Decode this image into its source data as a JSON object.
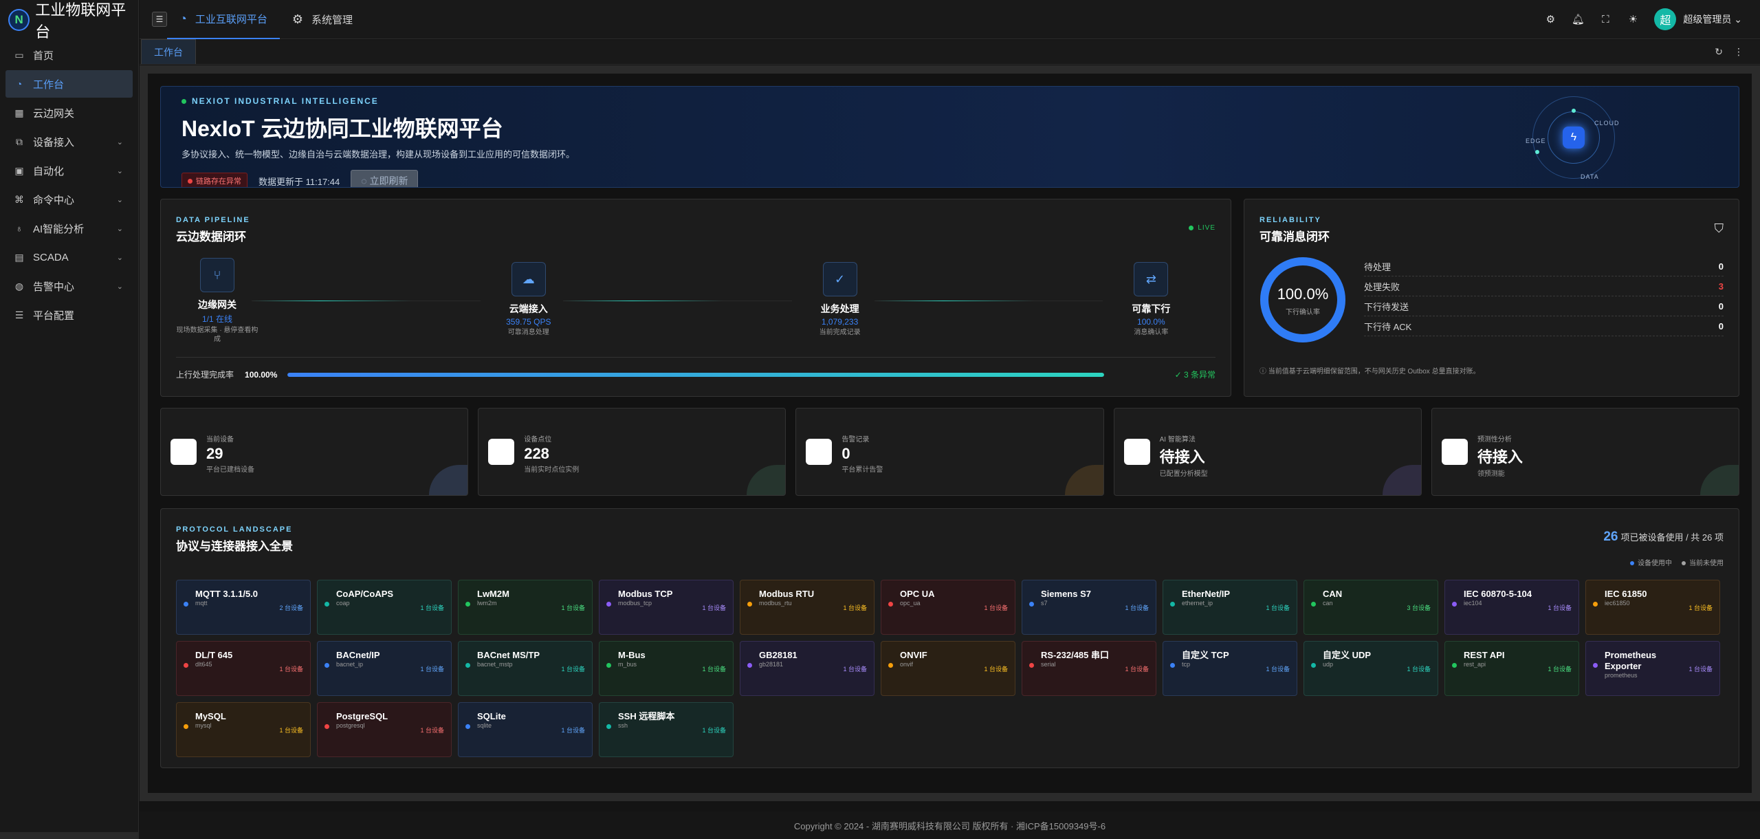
{
  "app": {
    "title": "工业物联网平台",
    "logo_letter": "N"
  },
  "sidebar": {
    "items": [
      {
        "label": "首页",
        "icon": "monitor-icon"
      },
      {
        "label": "工作台",
        "icon": "dashboard-icon",
        "active": true
      },
      {
        "label": "云边网关",
        "icon": "table-icon"
      },
      {
        "label": "设备接入",
        "icon": "device-icon",
        "expandable": true
      },
      {
        "label": "自动化",
        "icon": "grid-icon",
        "expandable": true
      },
      {
        "label": "命令中心",
        "icon": "command-icon",
        "expandable": true
      },
      {
        "label": "AI智能分析",
        "icon": "bulb-icon",
        "expandable": true
      },
      {
        "label": "SCADA",
        "icon": "screen-icon",
        "expandable": true
      },
      {
        "label": "告警中心",
        "icon": "alarm-icon",
        "expandable": true
      },
      {
        "label": "平台配置",
        "icon": "sliders-icon"
      }
    ]
  },
  "topbar": {
    "tabs": [
      {
        "label": "工业互联网平台"
      },
      {
        "label": "系统管理"
      }
    ],
    "user": {
      "avatar": "超",
      "name": "超级管理员"
    }
  },
  "page_tabs": [
    {
      "label": "工作台"
    }
  ],
  "hero": {
    "eyebrow": "NEXIOT INDUSTRIAL INTELLIGENCE",
    "title": "NexIoT 云边协同工业物联网平台",
    "subtitle": "多协议接入、统一物模型、边缘自治与云端数据治理，构建从现场设备到工业应用的可信数据闭环。",
    "badge": "链路存在异常",
    "updated": "数据更新于 11:17:44",
    "refresh": "立即刷新",
    "orbit_labels": {
      "edge": "EDGE",
      "cloud": "CLOUD",
      "data": "DATA"
    }
  },
  "pipeline": {
    "eyebrow": "DATA PIPELINE",
    "title": "云边数据闭环",
    "live": "LIVE",
    "stages": [
      {
        "name": "边缘网关",
        "value": "1/1 在线",
        "desc": "现场数据采集 · 悬停查看构成",
        "icon": "branch-icon"
      },
      {
        "name": "云端接入",
        "value": "359.75 QPS",
        "desc": "可靠消息处理",
        "icon": "cloud-icon"
      },
      {
        "name": "业务处理",
        "value": "1,079,233",
        "desc": "当前完成记录",
        "icon": "check-circle-icon"
      },
      {
        "name": "可靠下行",
        "value": "100.0%",
        "desc": "消息确认率",
        "icon": "swap-icon"
      }
    ],
    "progress_label": "上行处理完成率",
    "progress_text": "100.00%",
    "progress": 1.0,
    "status": "3 条异常"
  },
  "reliability": {
    "eyebrow": "RELIABILITY",
    "title": "可靠消息闭环",
    "ring_value": "100.0%",
    "ring_label": "下行确认率",
    "ring_fraction": 1.0,
    "items": [
      {
        "label": "待处理",
        "value": "0"
      },
      {
        "label": "处理失败",
        "value": "3",
        "alert": true
      },
      {
        "label": "下行待发送",
        "value": "0"
      },
      {
        "label": "下行待 ACK",
        "value": "0"
      }
    ],
    "note": "当前值基于云端明细保留范围，不与网关历史 Outbox 总量直接对账。"
  },
  "stats": [
    {
      "label": "当前设备",
      "value": "29",
      "desc": "平台已建档设备",
      "color": "#3b4a6b"
    },
    {
      "label": "设备点位",
      "value": "228",
      "desc": "当前实时点位实例",
      "color": "#2f4a3e"
    },
    {
      "label": "告警记录",
      "value": "0",
      "desc": "平台累计告警",
      "color": "#5a4325"
    },
    {
      "label": "AI 智能算法",
      "value": "待接入",
      "desc": "已配置分析模型",
      "color": "#3f3a5e"
    },
    {
      "label": "预测性分析",
      "value": "待接入",
      "desc": "领预测能",
      "color": "#2f4a3e"
    }
  ],
  "protocols": {
    "eyebrow": "PROTOCOL LANDSCAPE",
    "title": "协议与连接器接入全景",
    "summary_count": "26",
    "summary_text": "项已被设备使用 / 共 26 项",
    "legend": [
      {
        "label": "设备使用中",
        "color": "#3b82f6"
      },
      {
        "label": "当前未使用",
        "color": "#a3a3a3"
      }
    ],
    "items": [
      {
        "name": "MQTT 3.1.1/5.0",
        "code": "mqtt",
        "usage": "2 台设备",
        "tone": "blue"
      },
      {
        "name": "CoAP/CoAPS",
        "code": "coap",
        "usage": "1 台设备",
        "tone": "teal"
      },
      {
        "name": "LwM2M",
        "code": "lwm2m",
        "usage": "1 台设备",
        "tone": "green"
      },
      {
        "name": "Modbus TCP",
        "code": "modbus_tcp",
        "usage": "1 台设备",
        "tone": "purple"
      },
      {
        "name": "Modbus RTU",
        "code": "modbus_rtu",
        "usage": "1 台设备",
        "tone": "orange"
      },
      {
        "name": "OPC UA",
        "code": "opc_ua",
        "usage": "1 台设备",
        "tone": "red"
      },
      {
        "name": "Siemens S7",
        "code": "s7",
        "usage": "1 台设备",
        "tone": "blue"
      },
      {
        "name": "EtherNet/IP",
        "code": "ethernet_ip",
        "usage": "1 台设备",
        "tone": "teal"
      },
      {
        "name": "CAN",
        "code": "can",
        "usage": "3 台设备",
        "tone": "green"
      },
      {
        "name": "IEC 60870-5-104",
        "code": "iec104",
        "usage": "1 台设备",
        "tone": "purple"
      },
      {
        "name": "IEC 61850",
        "code": "iec61850",
        "usage": "1 台设备",
        "tone": "orange"
      },
      {
        "name": "DL/T 645",
        "code": "dlt645",
        "usage": "1 台设备",
        "tone": "red"
      },
      {
        "name": "BACnet/IP",
        "code": "bacnet_ip",
        "usage": "1 台设备",
        "tone": "blue"
      },
      {
        "name": "BACnet MS/TP",
        "code": "bacnet_mstp",
        "usage": "1 台设备",
        "tone": "teal"
      },
      {
        "name": "M-Bus",
        "code": "m_bus",
        "usage": "1 台设备",
        "tone": "green"
      },
      {
        "name": "GB28181",
        "code": "gb28181",
        "usage": "1 台设备",
        "tone": "purple"
      },
      {
        "name": "ONVIF",
        "code": "onvif",
        "usage": "1 台设备",
        "tone": "orange"
      },
      {
        "name": "RS-232/485 串口",
        "code": "serial",
        "usage": "1 台设备",
        "tone": "red"
      },
      {
        "name": "自定义 TCP",
        "code": "tcp",
        "usage": "1 台设备",
        "tone": "blue"
      },
      {
        "name": "自定义 UDP",
        "code": "udp",
        "usage": "1 台设备",
        "tone": "teal"
      },
      {
        "name": "REST API",
        "code": "rest_api",
        "usage": "1 台设备",
        "tone": "green"
      },
      {
        "name": "Prometheus Exporter",
        "code": "prometheus",
        "usage": "1 台设备",
        "tone": "purple"
      },
      {
        "name": "MySQL",
        "code": "mysql",
        "usage": "1 台设备",
        "tone": "orange"
      },
      {
        "name": "PostgreSQL",
        "code": "postgresql",
        "usage": "1 台设备",
        "tone": "red"
      },
      {
        "name": "SQLite",
        "code": "sqlite",
        "usage": "1 台设备",
        "tone": "blue"
      },
      {
        "name": "SSH 远程脚本",
        "code": "ssh",
        "usage": "1 台设备",
        "tone": "teal"
      }
    ]
  },
  "footer": {
    "text": "Copyright © 2024 - 湖南赛明威科技有限公司 版权所有 · 湘ICP备15009349号-6"
  }
}
